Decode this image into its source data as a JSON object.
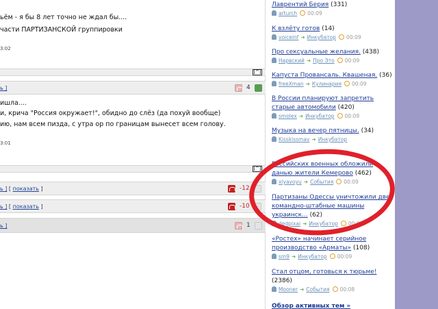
{
  "left": {
    "post1_line1": "ьём - я бы 8 лет точно не ждал бы....",
    "post1_line2": "части ПАРТИЗАНСКОЙ группировки",
    "post1_time": "3:02",
    "up_label": "[^]",
    "bar2_link": "ь ]",
    "bar2_score": "4",
    "post2_line1": "ишла....",
    "post2_line2": "и, крича \"Россия окружает!\", обидно до слёз (да похуй вообще)",
    "post2_line3": "ию, нам всем пизда, с утра ор по границам вынесет всем голову.",
    "post2_time": "3:01",
    "row1_link": "ь ]",
    "row1_sep": " [ ",
    "row1_show": "показать",
    "row1_end": " ]",
    "row1_score": "-12",
    "row2_link": "ь ]",
    "row2_show": "показать",
    "row2_score": "-10",
    "row3_link": "ь ]",
    "row3_score": "1"
  },
  "sidebar": {
    "items": [
      {
        "title": "Лаврентий Берия",
        "count": " (331)",
        "user": "arturch",
        "category": "",
        "time": "00:09"
      },
      {
        "title": "К взлёту готов",
        "count": " (14)",
        "user": "voiceinf",
        "category": "Инкубатор",
        "time": "00:09"
      },
      {
        "title": "Про сексуальные желания.",
        "count": " (438)",
        "user": "Нарвский",
        "category": "Про Это",
        "time": "00:09"
      },
      {
        "title": "Капуста Провансаль. Квашеная.",
        "count": " (36)",
        "user": "freeXman",
        "category": "Кулинария",
        "time": "00:09"
      },
      {
        "title": "В России планируют запретить старые автомобили",
        "count": " (420)",
        "user": "smolex",
        "category": "Инкубатор",
        "time": "00:09"
      },
      {
        "title": "Музыка на вечер пятницы.",
        "count": " (34)",
        "user": "Kisskissmav",
        "category": "Инкубатор",
        "time": ""
      },
      {
        "title": "Российских военных обложили данью жители Кемерово",
        "count": " (462)",
        "user": "xiyavoyu",
        "category": "События",
        "time": "00:09"
      },
      {
        "title": "Партизаны Одессы уничтожили две командно-штабные машины украинск...",
        "count": " (62)",
        "user": "dedpixai",
        "category": "Инкубатор",
        "time": "00:09"
      },
      {
        "title": "«Ростех» начинает серийное производство «Арматы»",
        "count": " (108)",
        "user": "sm9",
        "category": "Инкубатор",
        "time": "00:09"
      },
      {
        "title": "Стал отцом, готовься к тюрьме!",
        "count": " (2386)",
        "user": "Mooner",
        "category": "События",
        "time": "00:08"
      }
    ],
    "overview": "Обзор активных тем »"
  },
  "colors": {
    "annotation": "#e0202a",
    "link": "#1e3c96",
    "side_panel": "#9e9ac8"
  }
}
